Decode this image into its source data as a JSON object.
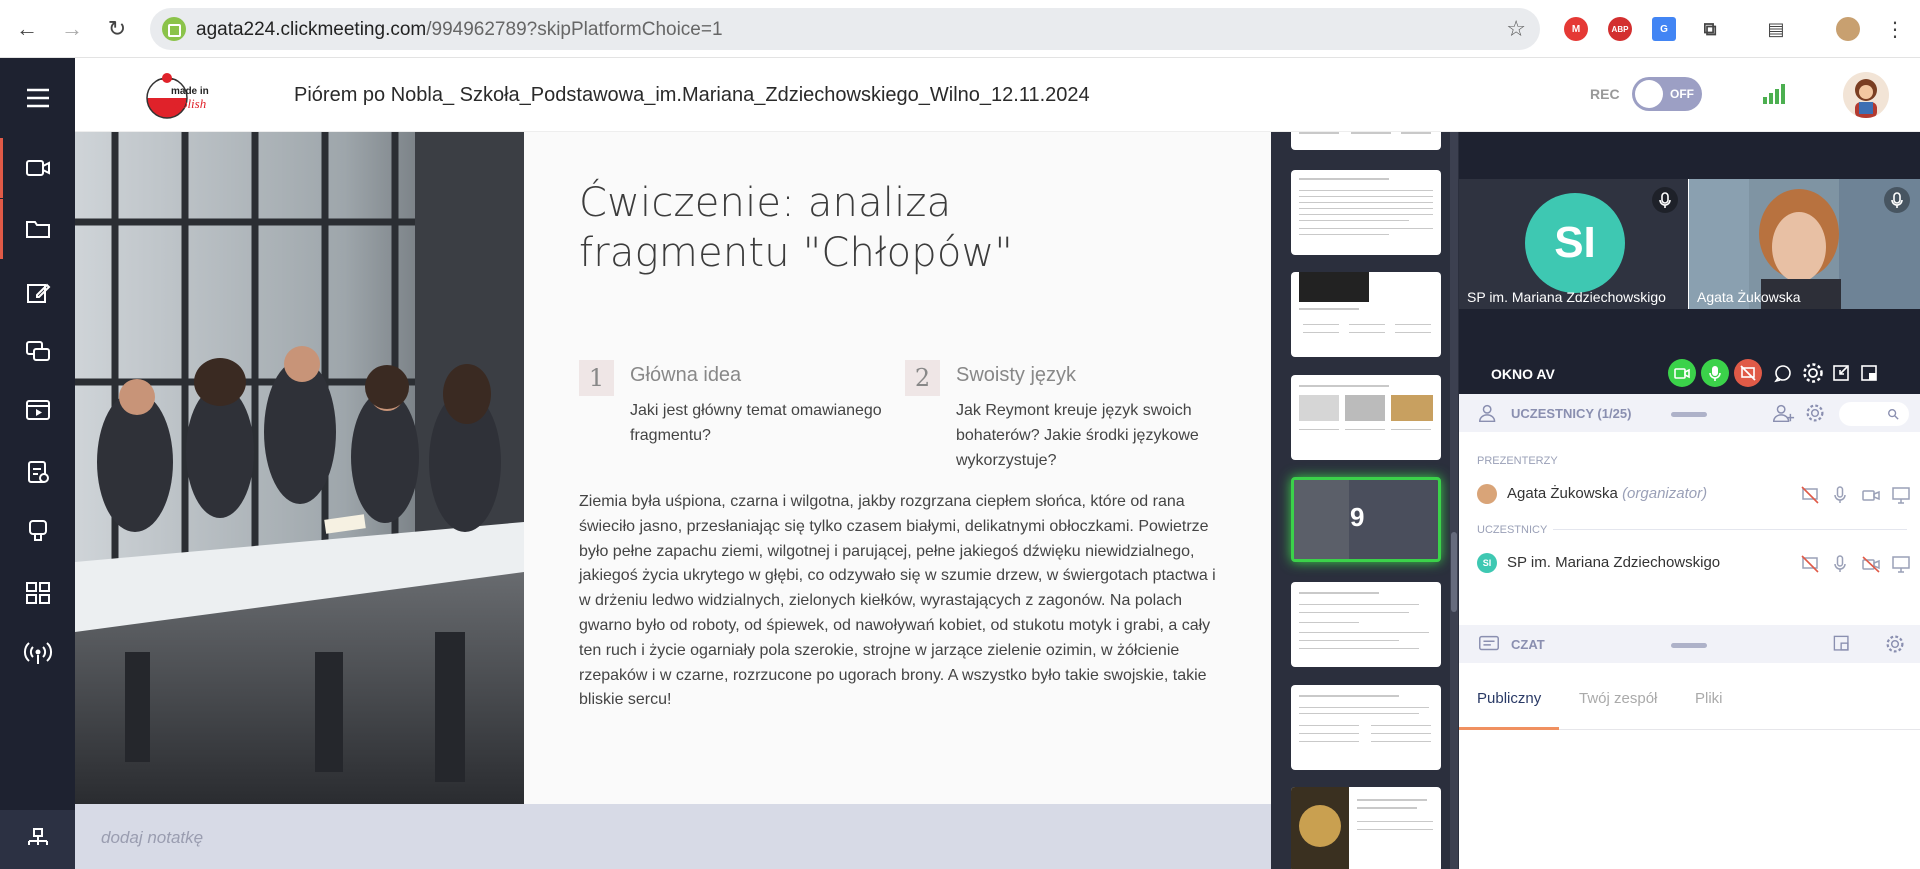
{
  "browser": {
    "url_host": "agata224.clickmeeting.com",
    "url_rest": "/994962789?skipPlatformChoice=1"
  },
  "header": {
    "meeting_title": "Piórem po Nobla_ Szkoła_Podstawowa_im.Mariana_Zdziechowskiego_Wilno_12.11.2024",
    "logo_text_top": "made in",
    "logo_text_bottom": "Polish",
    "rec_label": "REC",
    "rec_state": "OFF"
  },
  "slide": {
    "heading": "Ćwiczenie: analiza fragmentu \"Chłopów\"",
    "points": [
      {
        "num": "1",
        "title": "Główna idea",
        "text": "Jaki jest główny temat omawianego fragmentu?"
      },
      {
        "num": "2",
        "title": "Swoisty język",
        "text": "Jak Reymont kreuje język swoich bohaterów? Jakie środki językowe wykorzystuje?"
      }
    ],
    "paragraph": "Ziemia była uśpiona, czarna i wilgotna, jakby rozgrzana ciepłem słońca, które od rana świeciło jasno, przesłaniając się tylko czasem białymi, delikatnymi obłoczkami. Powietrze było pełne zapachu ziemi, wilgotnej i parującej, pełne jakiegoś dźwięku niewidzialnego, jakiegoś życia ukrytego w głębi, co odzywało się w szumie drzew, w świergotach ptactwa i w drżeniu ledwo widzialnych, zielonych kiełków, wyrastających z zagonów. Na polach gwarno było od roboty, od śpiewek, od nawoływań kobiet, od stukotu motyk i grabi, a cały ten ruch i życie ogarniały pola szerokie, strojne w jarzące zielenie ozimin, w żółcienie rzepaków i w czarne, rozrzucone po ugorach brony. A wszystko było takie swojskie, takie bliskie sercu!"
  },
  "notes": {
    "placeholder": "dodaj notatkę"
  },
  "thumbnails": {
    "current_number": "9"
  },
  "video": {
    "tile1_initials": "SI",
    "tile1_name": "SP im. Mariana Zdziechowskigo",
    "tile2_name": "Agata Żukowska",
    "av_window_label": "OKNO AV"
  },
  "participants": {
    "header": "UCZESTNICY (1/25)",
    "presenters_label": "PREZENTERZY",
    "presenter_name": "Agata Żukowska",
    "presenter_role": "(organizator)",
    "attendees_label": "UCZESTNICY",
    "attendee_initials": "SI",
    "attendee_name": "SP im. Mariana Zdziechowskigo"
  },
  "chat": {
    "header": "CZAT",
    "tabs": [
      "Publiczny",
      "Twój zespół",
      "Pliki"
    ]
  },
  "colors": {
    "rail_bg": "#1e2230",
    "accent_green": "#3bd24a",
    "accent_red": "#e05a47",
    "teal": "#3ec8b2",
    "tab_underline": "#f09060"
  }
}
